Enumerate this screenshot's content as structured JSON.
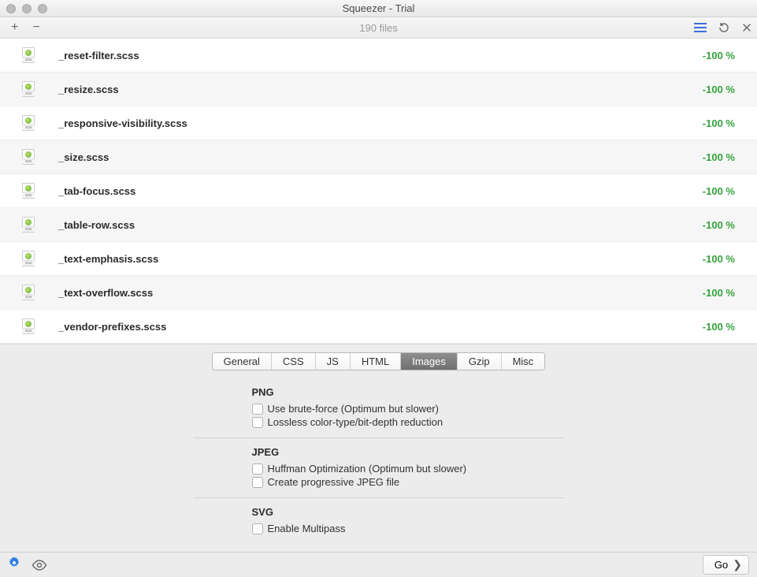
{
  "window": {
    "title": "Squeezer - Trial"
  },
  "toolbar": {
    "file_count": "190 files"
  },
  "files": [
    {
      "name": "_reset-filter.scss",
      "pct": "-100 %"
    },
    {
      "name": "_resize.scss",
      "pct": "-100 %"
    },
    {
      "name": "_responsive-visibility.scss",
      "pct": "-100 %"
    },
    {
      "name": "_size.scss",
      "pct": "-100 %"
    },
    {
      "name": "_tab-focus.scss",
      "pct": "-100 %"
    },
    {
      "name": "_table-row.scss",
      "pct": "-100 %"
    },
    {
      "name": "_text-emphasis.scss",
      "pct": "-100 %"
    },
    {
      "name": "_text-overflow.scss",
      "pct": "-100 %"
    },
    {
      "name": "_vendor-prefixes.scss",
      "pct": "-100 %"
    }
  ],
  "tabs": [
    "General",
    "CSS",
    "JS",
    "HTML",
    "Images",
    "Gzip",
    "Misc"
  ],
  "active_tab": "Images",
  "sections": {
    "png": {
      "title": "PNG",
      "opt1": "Use brute-force (Optimum but slower)",
      "opt2": "Lossless color-type/bit-depth reduction"
    },
    "jpeg": {
      "title": "JPEG",
      "opt1": "Huffman Optimization (Optimum but slower)",
      "opt2": "Create progressive JPEG file"
    },
    "svg": {
      "title": "SVG",
      "opt1": "Enable Multipass"
    }
  },
  "bottom": {
    "go": "Go"
  }
}
